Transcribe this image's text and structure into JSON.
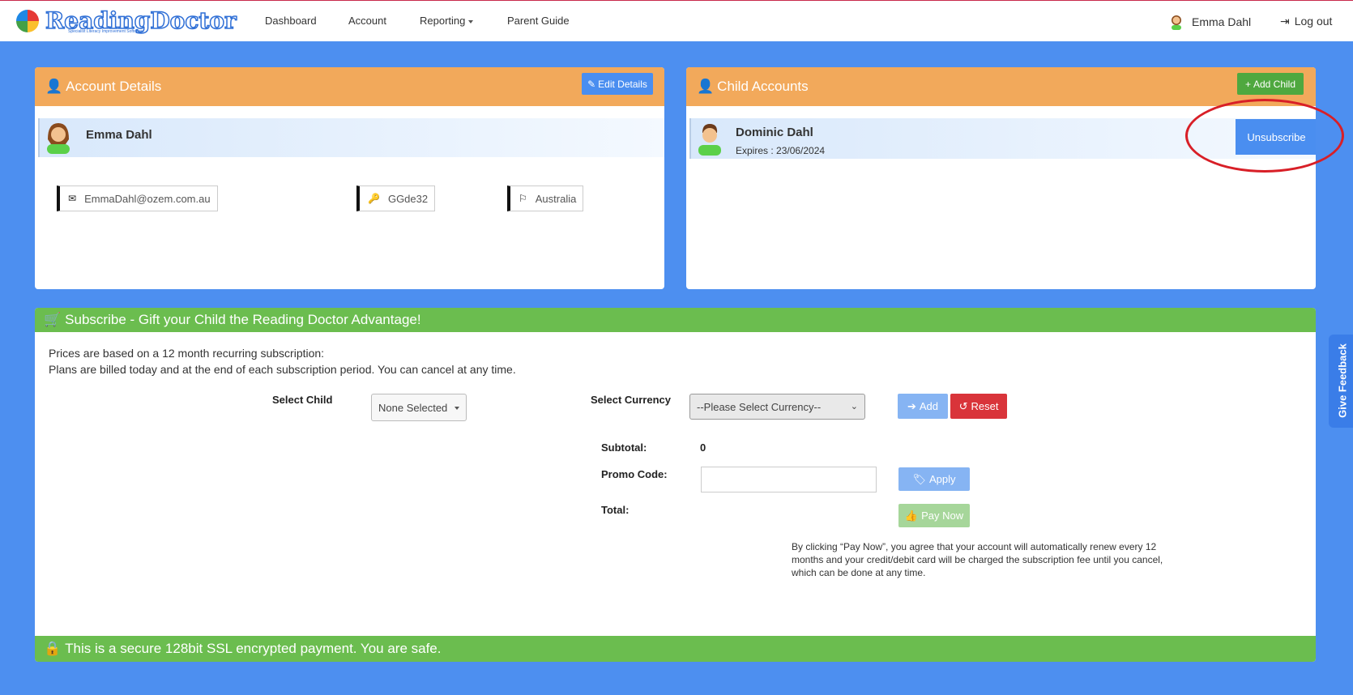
{
  "brand": {
    "name": "ReadingDoctor",
    "tagline": "Specialist Literacy Improvement Software"
  },
  "nav": {
    "dashboard": "Dashboard",
    "account": "Account",
    "reporting": "Reporting",
    "parent_guide": "Parent Guide"
  },
  "user": {
    "name": "Emma Dahl",
    "logout": "Log out"
  },
  "account_details": {
    "title": "Account Details",
    "edit_button": "Edit Details",
    "name": "Emma Dahl",
    "email": "EmmaDahl@ozem.com.au",
    "password": "GGde32",
    "country": "Australia"
  },
  "child_accounts": {
    "title": "Child Accounts",
    "add_button": "Add Child",
    "child": {
      "name": "Dominic Dahl",
      "expires": "Expires : 23/06/2024",
      "unsubscribe": "Unsubscribe"
    }
  },
  "subscribe": {
    "title": "Subscribe - Gift your Child the Reading Doctor Advantage!",
    "line1": "Prices are based on a 12 month recurring subscription:",
    "line2": "Plans are billed today and at the end of each subscription period. You can cancel at any time.",
    "select_child_label": "Select Child",
    "select_child_value": "None Selected",
    "select_currency_label": "Select Currency",
    "select_currency_value": "--Please Select Currency--",
    "add_button": "Add",
    "reset_button": "Reset",
    "subtotal_label": "Subtotal:",
    "subtotal_value": "0",
    "promo_label": "Promo Code:",
    "apply_button": "Apply",
    "total_label": "Total:",
    "pay_button": "Pay Now",
    "disclaimer_1": "By clicking “Pay Now”, you agree that your account will automatically renew every 12",
    "disclaimer_2": "months and your credit/debit card will be charged the subscription fee until you cancel,",
    "disclaimer_3": "which can be done at any time.",
    "secure_text": "This is a secure 128bit SSL encrypted payment. You are safe."
  },
  "feedback": "Give Feedback",
  "colors": {
    "background": "#4d8ff0",
    "header_orange": "#f2a95b",
    "green": "#6bbd4f",
    "blue_button": "#4a8ef0",
    "red_button": "#d9343a",
    "highlight_circle": "#d81f27"
  }
}
